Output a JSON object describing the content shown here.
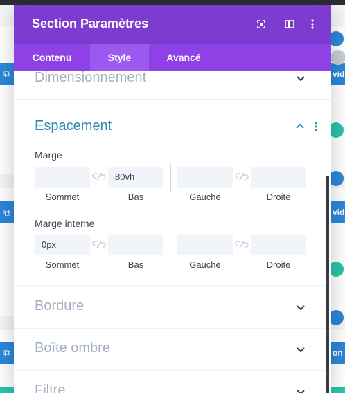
{
  "modal": {
    "title": "Section Paramètres",
    "tabs": [
      {
        "label": "Contenu",
        "active": false
      },
      {
        "label": "Style",
        "active": true
      },
      {
        "label": "Avancé",
        "active": false
      }
    ],
    "header_icons": [
      "expand-icon",
      "sidebar-layout-icon",
      "more-vertical-icon"
    ]
  },
  "sections": {
    "dimensionnement": "Dimensionnement",
    "espacement": {
      "title": "Espacement",
      "marge": {
        "label": "Marge",
        "fields": [
          {
            "sub_label": "Sommet",
            "value": ""
          },
          {
            "sub_label": "Bas",
            "value": "80vh"
          },
          {
            "sub_label": "Gauche",
            "value": ""
          },
          {
            "sub_label": "Droite",
            "value": ""
          }
        ]
      },
      "marge_interne": {
        "label": "Marge interne",
        "fields": [
          {
            "sub_label": "Sommet",
            "value": "0px"
          },
          {
            "sub_label": "Bas",
            "value": ""
          },
          {
            "sub_label": "Gauche",
            "value": ""
          },
          {
            "sub_label": "Droite",
            "value": ""
          }
        ]
      }
    },
    "bordure": "Bordure",
    "boite_ombre": "Boîte ombre",
    "filtre": "Filtre"
  },
  "background": {
    "right_buttons": [
      "vid",
      "vid",
      "on"
    ]
  },
  "colors": {
    "header": "#7e3bd0",
    "tabs_bar": "#8e42e6",
    "active_tab": "#9c59ef",
    "accent_title": "#2e8bb4",
    "builder_blue": "#2b87da",
    "builder_green": "#29c4a9"
  }
}
